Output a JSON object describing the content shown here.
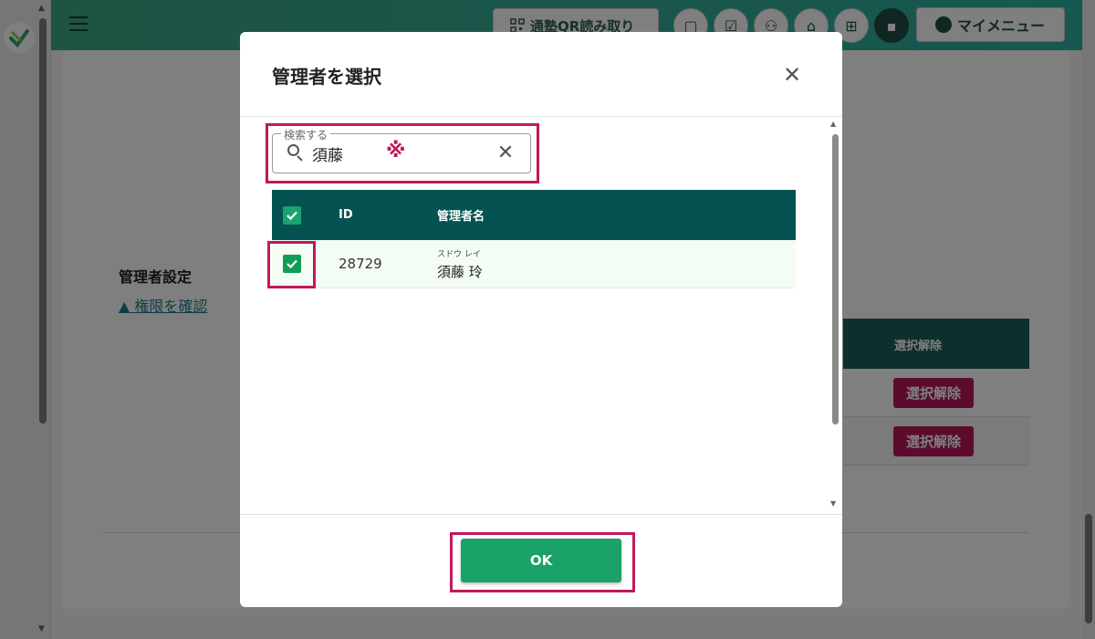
{
  "header": {
    "qr_button_label": "通塾QR読み取り",
    "my_menu_label": "マイメニュー",
    "icons": [
      "chat-bubble-icon",
      "checklist-icon",
      "group-icon",
      "school-icon",
      "gift-icon",
      "message-icon"
    ]
  },
  "page": {
    "section_heading": "管理者設定",
    "permission_link": "▲ 権限を確認",
    "background_table": {
      "header_label": "選択解除",
      "row_buttons": [
        "選択解除",
        "選択解除"
      ]
    }
  },
  "modal": {
    "title": "管理者を選択",
    "close_icon": "close-icon",
    "search": {
      "label": "検索する",
      "value": "須藤",
      "annotation_mark": "※"
    },
    "table": {
      "columns": [
        "ID",
        "管理者名"
      ],
      "header_checked": true,
      "rows": [
        {
          "checked": true,
          "id": "28729",
          "kana": "スドウ レイ",
          "name": "須藤 玲"
        }
      ]
    },
    "ok_label": "OK"
  },
  "colors": {
    "header_gradient_start": "#3aa987",
    "header_gradient_end": "#2fb0a2",
    "table_header": "#045251",
    "ok_button": "#1aa268",
    "highlight": "#c2185b",
    "deselect_button": "#b8175a"
  }
}
